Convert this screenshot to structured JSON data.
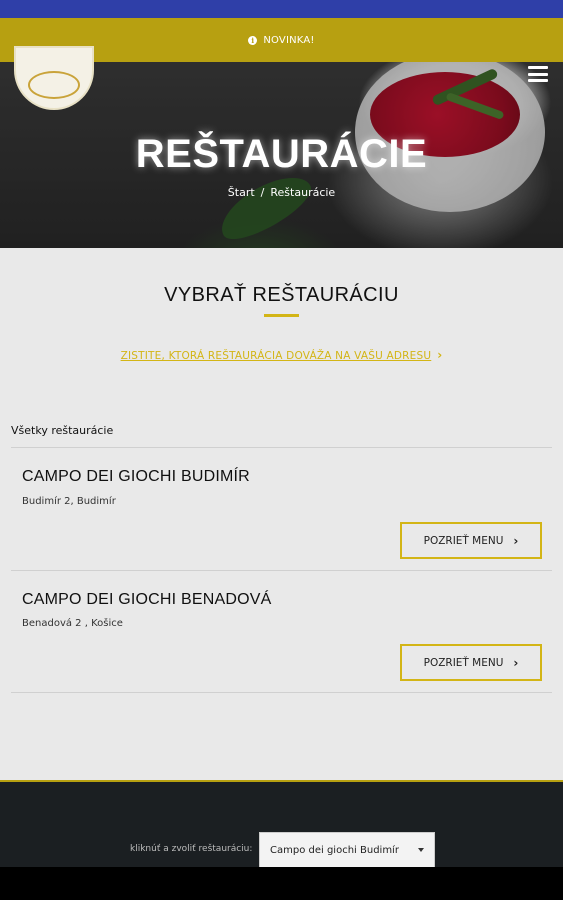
{
  "promo": {
    "icon": "info-icon",
    "label": "NOVINKA!"
  },
  "hero": {
    "title": "REŠTAURÁCIE",
    "breadcrumb": {
      "home": "Štart",
      "separator": "/",
      "current": "Reštaurácie"
    }
  },
  "main": {
    "heading": "VYBRAŤ REŠTAURÁCIU",
    "address_link": "ZISTITE, KTORÁ REŠTAURÁCIA DOVÁŽA NA VAŠU ADRESU",
    "list_label": "Všetky reštaurácie",
    "restaurants": [
      {
        "name": "CAMPO DEI GIOCHI BUDIMÍR",
        "address": "Budimír 2, Budimír",
        "button": "POZRIEŤ MENU"
      },
      {
        "name": "CAMPO DEI GIOCHI BENADOVÁ",
        "address": "Benadová 2 , Košice",
        "button": "POZRIEŤ MENU"
      }
    ]
  },
  "footer": {
    "select_label": "kliknúť a zvoliť reštauráciu:",
    "select_value": "Campo dei giochi Budimír"
  },
  "colors": {
    "accent": "#d3b516",
    "promo_bar": "#b7a011",
    "status_bar": "#2f3fa8",
    "footer": "#1b1f22"
  }
}
